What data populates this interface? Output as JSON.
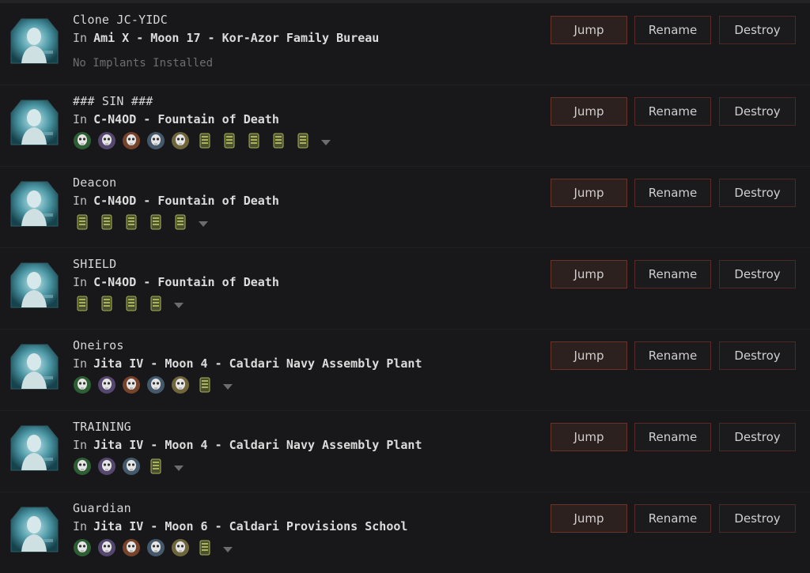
{
  "buttons": {
    "jump": "Jump",
    "rename": "Rename",
    "destroy": "Destroy"
  },
  "clones": [
    {
      "name": "Clone JC-YIDC",
      "in": "In",
      "location": "Ami X - Moon 17 - Kor-Azor Family Bureau",
      "no_implants": "No Implants Installed",
      "implants": []
    },
    {
      "name": "### SIN ###",
      "in": "In",
      "location": "C-N4OD - Fountain of Death",
      "implants": [
        "green-skull-implant",
        "purple-skull-implant",
        "orange-skull-implant",
        "blue-skull-implant",
        "gold-skull-implant",
        "hardwiring-implant",
        "hardwiring-implant",
        "hardwiring-implant",
        "hardwiring-implant",
        "hardwiring-implant"
      ]
    },
    {
      "name": "Deacon",
      "in": "In",
      "location": "C-N4OD - Fountain of Death",
      "implants": [
        "hardwiring-implant",
        "hardwiring-implant",
        "hardwiring-implant",
        "hardwiring-implant",
        "hardwiring-implant"
      ]
    },
    {
      "name": "SHIELD",
      "in": "In",
      "location": "C-N4OD - Fountain of Death",
      "implants": [
        "hardwiring-implant",
        "hardwiring-implant",
        "hardwiring-implant",
        "hardwiring-implant"
      ]
    },
    {
      "name": "Oneiros",
      "in": "In",
      "location": "Jita IV - Moon 4 - Caldari Navy Assembly Plant",
      "implants": [
        "green-skull-implant",
        "purple-skull-implant",
        "orange-skull-implant",
        "blue-skull-implant",
        "gold-skull-implant",
        "hardwiring-implant"
      ]
    },
    {
      "name": "TRAINING",
      "in": "In",
      "location": "Jita IV - Moon 4 - Caldari Navy Assembly Plant",
      "implants": [
        "green-skull-implant",
        "purple-skull-implant",
        "blue-skull-implant",
        "hardwiring-implant"
      ]
    },
    {
      "name": "Guardian",
      "in": "In",
      "location": "Jita IV - Moon 6 - Caldari Provisions School",
      "implants": [
        "green-skull-implant",
        "purple-skull-implant",
        "orange-skull-implant",
        "blue-skull-implant",
        "gold-skull-implant",
        "hardwiring-implant"
      ]
    }
  ],
  "colors": {
    "green": "#3f9a4a",
    "purple": "#8a6fb4",
    "orange": "#c8683a",
    "blue": "#6c8fb3",
    "gold": "#b9a85a",
    "hardwiring": "#a7b45a"
  }
}
